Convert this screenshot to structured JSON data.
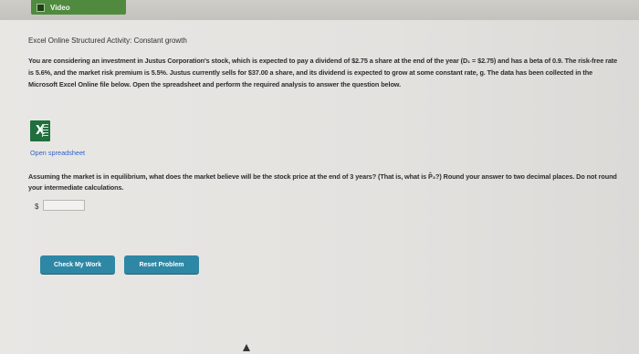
{
  "tab": {
    "label": "Video",
    "icon": "video-icon"
  },
  "activity": {
    "title": "Excel Online Structured Activity: Constant growth",
    "description": "You are considering an investment in Justus Corporation's stock, which is expected to pay a dividend of $2.75 a share at the end of the year (D₁ = $2.75) and has a beta of 0.9. The risk-free rate is 5.6%, and the market risk premium is 5.5%. Justus currently sells for $37.00 a share, and its dividend is expected to grow at some constant rate, g. The data has been collected in the Microsoft Excel Online file below. Open the spreadsheet and perform the required analysis to answer the question below."
  },
  "spreadsheet": {
    "icon": "excel-icon",
    "icon_letter": "X",
    "link_label": "Open spreadsheet"
  },
  "question": {
    "text": "Assuming the market is in equilibrium, what does the market believe will be the stock price at the end of 3 years? (That is, what is P̂₃?) Round your answer to two decimal places. Do not round your intermediate calculations."
  },
  "answer": {
    "currency_symbol": "$",
    "value": ""
  },
  "buttons": {
    "check_label": "Check My Work",
    "reset_label": "Reset Problem"
  },
  "colors": {
    "tab_green": "#4f8a3f",
    "excel_green": "#1f6f3f",
    "button_teal": "#2e87a4",
    "link_blue": "#2f63c8"
  }
}
